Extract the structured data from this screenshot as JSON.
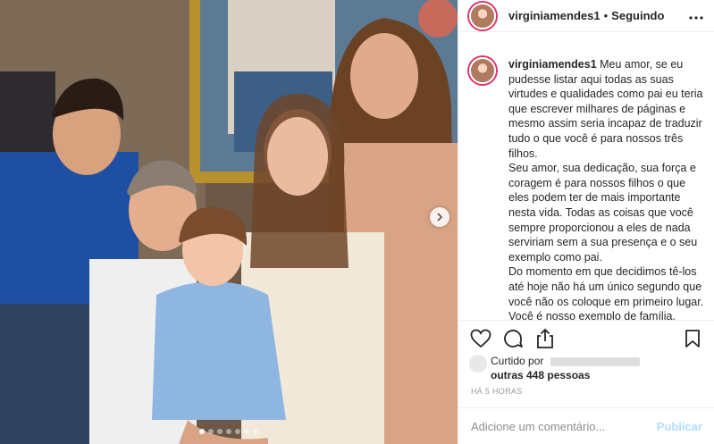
{
  "post": {
    "username": "virginiamendes1",
    "separator": "•",
    "follow_status": "Seguindo",
    "more_icon": "more-horizontal-icon"
  },
  "caption": {
    "username": "virginiamendes1",
    "text": " Meu amor, se eu pudesse listar aqui todas as suas virtudes e qualidades como pai eu teria que escrever milhares de páginas e mesmo assim seria incapaz de traduzir tudo o que você é para nossos três filhos.\nSeu amor, sua dedicação, sua força e coragem é para nossos filhos o que eles podem ter de mais importante nesta vida. Todas as coisas que você sempre proporcionou a eles de nada serviriam sem a sua presença e o seu exemplo como pai.\nDo momento em que decidimos tê-los até hoje não há um único segundo que você não os coloque em primeiro lugar. Você é nosso exemplo de família."
  },
  "actions": {
    "like_icon": "heart-icon",
    "comment_icon": "comment-bubble-icon",
    "share_icon": "share-icon",
    "save_icon": "bookmark-icon"
  },
  "likes": {
    "liked_by_label": "Curtido por",
    "others_text": "outras 448 pessoas"
  },
  "timestamp": "HÁ 5 HORAS",
  "comment": {
    "placeholder": "Adicione um comentário...",
    "publish_label": "Publicar"
  },
  "carousel": {
    "dot_count": 7,
    "active_index": 0
  },
  "colors": {
    "story_ring": "#e1306c",
    "publish_disabled": "#b2dffc",
    "text": "#262626",
    "muted": "#8e8e8e"
  }
}
